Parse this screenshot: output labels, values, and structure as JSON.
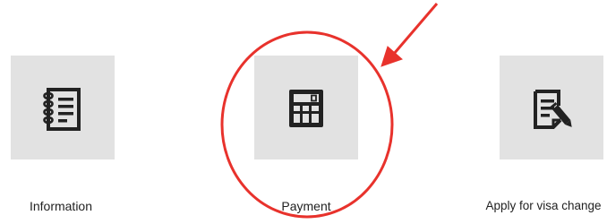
{
  "tiles": [
    {
      "label": "Information",
      "icon": "notebook-icon"
    },
    {
      "label": "Payment",
      "icon": "calculator-icon"
    },
    {
      "label": "Apply for visa change",
      "icon": "document-edit-icon"
    }
  ],
  "colors": {
    "tile_background": "#e2e2e2",
    "icon": "#222222",
    "annotation": "#e8322c"
  }
}
